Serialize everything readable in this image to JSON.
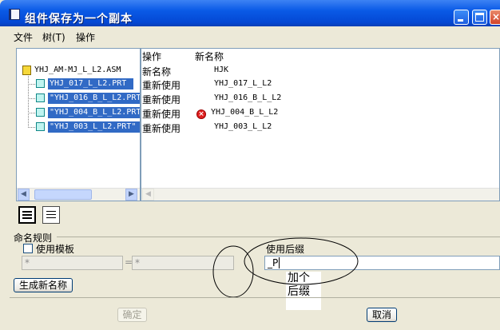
{
  "window": {
    "title": "组件保存为一个副本",
    "controls": [
      "minimize-icon",
      "maximize-icon",
      "close-icon"
    ]
  },
  "menu": [
    "文件",
    "树(T)",
    "操作"
  ],
  "tree": {
    "columns": {
      "operation": "操作",
      "new_name": "新名称"
    },
    "root": {
      "label": "YHJ_AM-MJ_L_L2.ASM",
      "operation": "新名称",
      "new_name": "HJK"
    },
    "children": [
      {
        "label": "YHJ_017_L_L2.PRT",
        "operation": "重新使用",
        "new_name": "YHJ_017_L_L2",
        "error": false
      },
      {
        "label": "\"YHJ_016_B_L_L2.PRT\"",
        "operation": "重新使用",
        "new_name": "YHJ_016_B_L_L2",
        "error": false
      },
      {
        "label": "\"YHJ_004_B_L_L2.PRT\"",
        "operation": "重新使用",
        "new_name": "YHJ_004_B_L_L2",
        "error": true
      },
      {
        "label": "\"YHJ_003_L_L2.PRT\"",
        "operation": "重新使用",
        "new_name": "YHJ_003_L_L2",
        "error": false
      }
    ]
  },
  "naming": {
    "section_label": "命名规则",
    "use_template_label": "使用模板",
    "use_template_checked": false,
    "template_field_left": "*",
    "template_field_right": "*",
    "equals": "=",
    "use_suffix_label": "使用后缀",
    "suffix_value": "_P",
    "generate_button": "生成新名称"
  },
  "annotation": {
    "line1": "加个",
    "line2": "后缀"
  },
  "buttons": {
    "ok": "确定",
    "cancel": "取消"
  },
  "colors": {
    "selection": "#316ac5",
    "title_bar": "#0a5ae6",
    "error": "#e02020"
  }
}
